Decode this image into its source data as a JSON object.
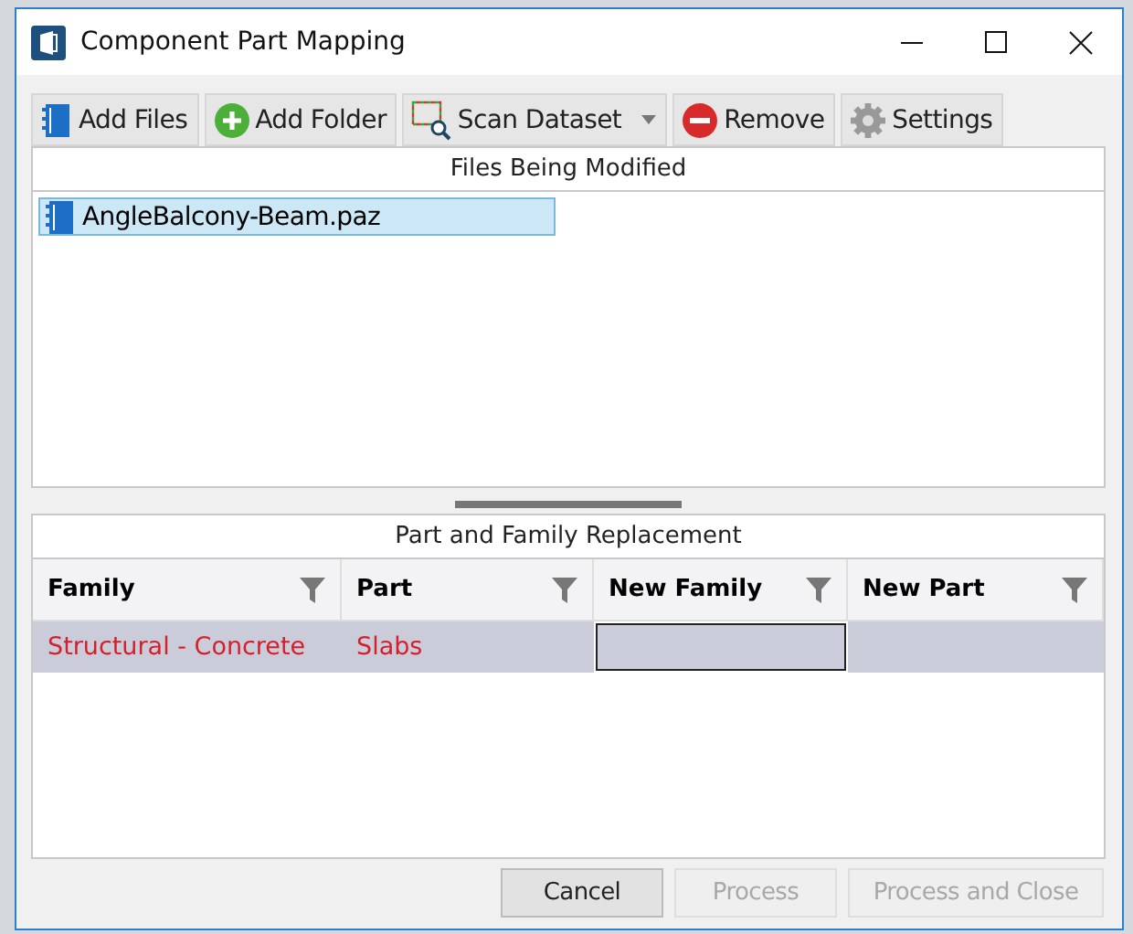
{
  "window": {
    "title": "Component Part Mapping"
  },
  "toolbar": [
    {
      "label": "Add Files",
      "dropdown": false
    },
    {
      "label": "Add Folder",
      "dropdown": false
    },
    {
      "label": "Scan Dataset",
      "dropdown": true
    },
    {
      "label": "Remove",
      "dropdown": false
    },
    {
      "label": "Settings",
      "dropdown": false
    }
  ],
  "files_panel": {
    "title": "Files Being Modified",
    "items": [
      {
        "name": "AngleBalcony-Beam.paz",
        "selected": true
      }
    ]
  },
  "mapping_panel": {
    "title": "Part and Family Replacement",
    "columns": [
      "Family",
      "Part",
      "New Family",
      "New Part"
    ],
    "rows": [
      {
        "selected": true,
        "cells": [
          {
            "text": "Structural - Concrete",
            "editing": false
          },
          {
            "text": "Slabs",
            "editing": false
          },
          {
            "editing": true
          },
          {
            "editing": false
          }
        ]
      }
    ]
  },
  "buttons": [
    {
      "label": "Cancel",
      "disabled": false
    },
    {
      "label": "Process",
      "disabled": true
    },
    {
      "label": "Process and Close",
      "disabled": true
    }
  ]
}
